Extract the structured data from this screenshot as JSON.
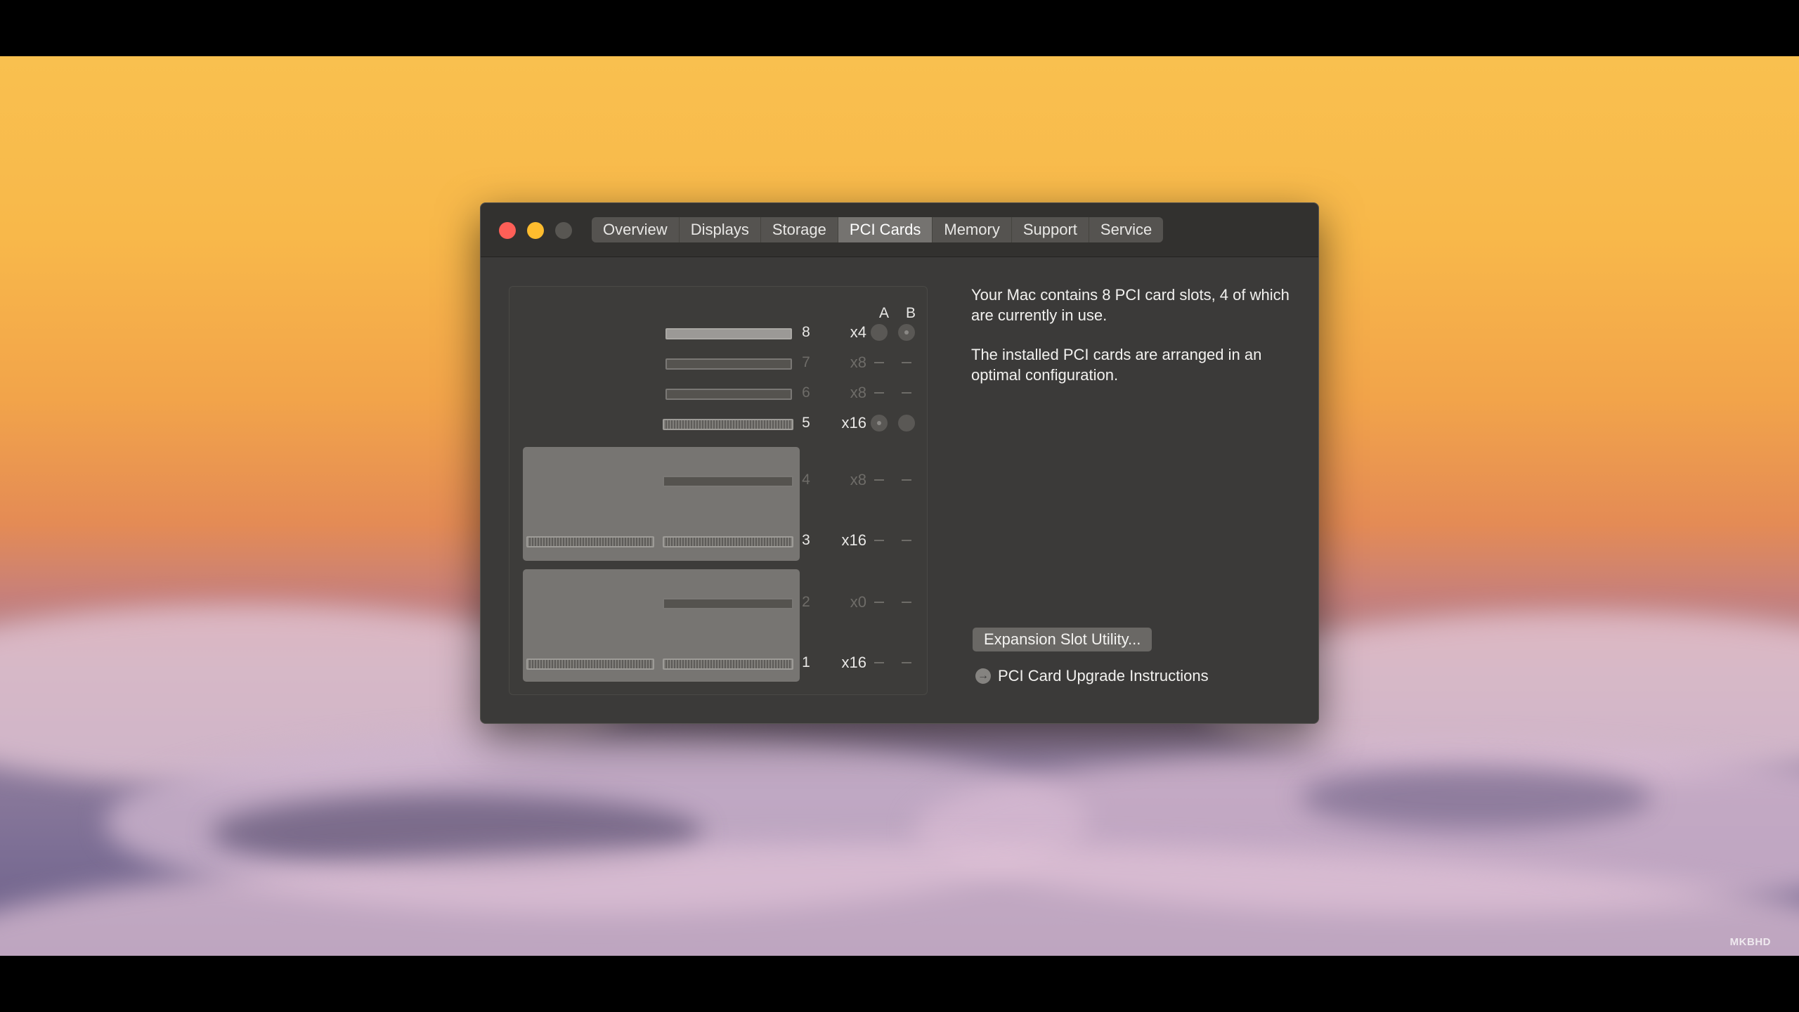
{
  "window": {
    "tabs": [
      {
        "label": "Overview",
        "active": false
      },
      {
        "label": "Displays",
        "active": false
      },
      {
        "label": "Storage",
        "active": false
      },
      {
        "label": "PCI Cards",
        "active": true
      },
      {
        "label": "Memory",
        "active": false
      },
      {
        "label": "Support",
        "active": false
      },
      {
        "label": "Service",
        "active": false
      }
    ]
  },
  "slots_panel": {
    "column_a": "A",
    "column_b": "B",
    "slots": [
      {
        "number": "8",
        "lanes": "x4",
        "in_use": true
      },
      {
        "number": "7",
        "lanes": "x8",
        "in_use": false
      },
      {
        "number": "6",
        "lanes": "x8",
        "in_use": false
      },
      {
        "number": "5",
        "lanes": "x16",
        "in_use": true
      },
      {
        "number": "4",
        "lanes": "x8",
        "in_use": false
      },
      {
        "number": "3",
        "lanes": "x16",
        "in_use": true
      },
      {
        "number": "2",
        "lanes": "x0",
        "in_use": false
      },
      {
        "number": "1",
        "lanes": "x16",
        "in_use": true
      }
    ]
  },
  "info": {
    "summary": "Your Mac contains 8 PCI card slots, 4 of which are currently in use.",
    "config": "The installed PCI cards are arranged in an optimal configuration.",
    "button_label": "Expansion Slot Utility...",
    "link_label": "PCI Card Upgrade Instructions"
  },
  "watermark": "MKBHD"
}
